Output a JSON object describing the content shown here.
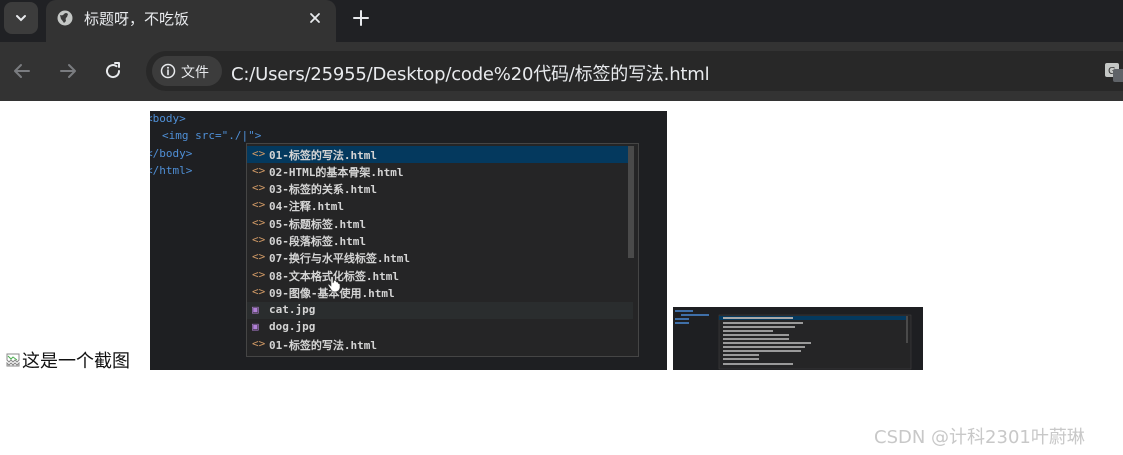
{
  "browser": {
    "tab": {
      "title": "标题呀，不吃饭"
    },
    "address": {
      "chip_label": "文件",
      "url": "C:/Users/25955/Desktop/code%20代码/标签的写法.html"
    }
  },
  "page": {
    "broken_image_alt": "这是一个截图",
    "screenshot": {
      "code_lines": [
        "<body>",
        "<img src=\"./|\">",
        "</body>",
        "</html>"
      ],
      "suggestions": [
        {
          "icon": "<>",
          "label": "01-标签的写法.html",
          "state": "selected"
        },
        {
          "icon": "<>",
          "label": "02-HTML的基本骨架.html"
        },
        {
          "icon": "<>",
          "label": "03-标签的关系.html"
        },
        {
          "icon": "<>",
          "label": "04-注释.html"
        },
        {
          "icon": "<>",
          "label": "05-标题标签.html"
        },
        {
          "icon": "<>",
          "label": "06-段落标签.html"
        },
        {
          "icon": "<>",
          "label": "07-换行与水平线标签.html"
        },
        {
          "icon": "<>",
          "label": "08-文本格式化标签.html"
        },
        {
          "icon": "<>",
          "label": "09-图像-基本使用.html"
        },
        {
          "icon": "img",
          "label": "cat.jpg",
          "state": "hover"
        },
        {
          "icon": "img",
          "label": "dog.jpg"
        },
        {
          "icon": "<>",
          "label": "01-标签的写法.html"
        }
      ]
    },
    "watermark": "CSDN @计科2301叶蔚琳"
  },
  "icons": {
    "tab_list": "chevron-down-icon",
    "tab_favicon": "globe-icon",
    "tab_close": "close-icon",
    "new_tab": "plus-icon",
    "back": "arrow-left-icon",
    "forward": "arrow-right-icon",
    "reload": "reload-icon",
    "site_info": "info-icon",
    "translate": "translate-icon"
  },
  "colors": {
    "chrome_dark": "#202124",
    "toolbar": "#333333",
    "editor_bg": "#1e1f22",
    "selection": "#04395e"
  }
}
